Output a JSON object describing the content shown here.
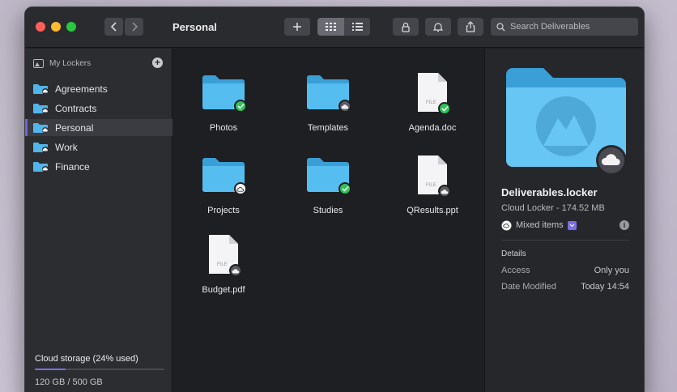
{
  "window": {
    "title": "Personal",
    "search_placeholder": "Search Deliverables"
  },
  "sidebar": {
    "section_title": "My Lockers",
    "items": [
      {
        "label": "Agreements"
      },
      {
        "label": "Contracts"
      },
      {
        "label": "Personal"
      },
      {
        "label": "Work"
      },
      {
        "label": "Finance"
      }
    ],
    "active_index": 2,
    "storage_title": "Cloud storage (24% used)",
    "storage_used_fraction": 0.24,
    "storage_amount": "120 GB / 500 GB"
  },
  "files": [
    {
      "name": "Photos",
      "kind": "folder",
      "status": "synced"
    },
    {
      "name": "Templates",
      "kind": "folder",
      "status": "cloud"
    },
    {
      "name": "Agenda.doc",
      "kind": "file",
      "status": "synced",
      "file_tag": "FILE"
    },
    {
      "name": "Projects",
      "kind": "folder",
      "status": "cloud-outline"
    },
    {
      "name": "Studies",
      "kind": "folder",
      "status": "synced"
    },
    {
      "name": "QResults.ppt",
      "kind": "file",
      "status": "cloud",
      "file_tag": "FILE"
    },
    {
      "name": "Budget.pdf",
      "kind": "file",
      "status": "cloud",
      "file_tag": "FILE"
    }
  ],
  "preview": {
    "name": "Deliverables.locker",
    "subtitle": "Cloud Locker - 174.52 MB",
    "mixed_label": "Mixed items",
    "details_title": "Details",
    "access_label": "Access",
    "access_value": "Only you",
    "modified_label": "Date Modified",
    "modified_value": "Today 14:54"
  },
  "colors": {
    "accent": "#7a6fe6",
    "folder": "#4fb5ea",
    "synced": "#30c25a"
  }
}
